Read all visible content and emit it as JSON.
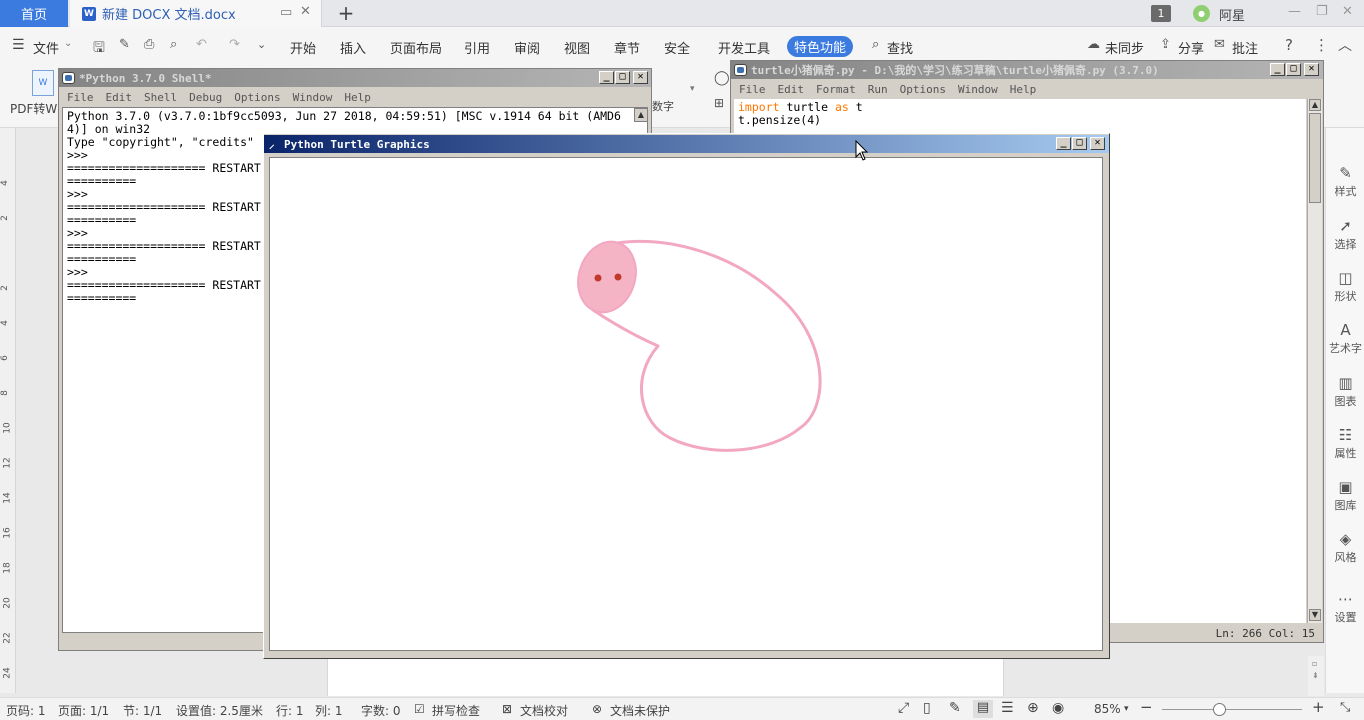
{
  "tabbar": {
    "home": "首页",
    "doc_tab": "新建 DOCX 文档.docx",
    "badge": "1",
    "user_avatar": "阿星",
    "user_name": "阿星"
  },
  "ribbon": {
    "file_menu": "文件",
    "tabs": [
      "开始",
      "插入",
      "页面布局",
      "引用",
      "审阅",
      "视图",
      "章节",
      "安全",
      "开发工具"
    ],
    "special": "特色功能",
    "search": "查找",
    "sync": "未同步",
    "share": "分享",
    "comment": "批注"
  },
  "toolbar2": {
    "pdf": "PDF转W",
    "word_art": "数字"
  },
  "ruler": [
    "4",
    "2",
    "2",
    "4",
    "6",
    "8",
    "10",
    "12",
    "14",
    "16",
    "18",
    "20",
    "22",
    "24"
  ],
  "sidebar": [
    "样式",
    "选择",
    "形状",
    "艺术字",
    "图表",
    "属性",
    "图库",
    "风格",
    "设置"
  ],
  "shell": {
    "title": "*Python 3.7.0 Shell*",
    "menu": [
      "File",
      "Edit",
      "Shell",
      "Debug",
      "Options",
      "Window",
      "Help"
    ],
    "lines": [
      "Python 3.7.0 (v3.7.0:1bf9cc5093, Jun 27 2018, 04:59:51) [MSC v.1914 64 bit (AMD6",
      "4)] on win32",
      "Type \"copyright\", \"credits\"",
      ">>>",
      "==================== RESTART",
      "==========",
      ">>>",
      "==================== RESTART",
      "==========",
      ">>>",
      "==================== RESTART",
      "==========",
      ">>>",
      "==================== RESTART",
      "=========="
    ]
  },
  "editor": {
    "title": "turtle小猪佩奇.py - D:\\我的\\学习\\练习草稿\\turtle小猪佩奇.py (3.7.0)",
    "menu": [
      "File",
      "Edit",
      "Format",
      "Run",
      "Options",
      "Window",
      "Help"
    ],
    "line1_kw": "import",
    "line1_mid": " turtle ",
    "line1_kw2": "as",
    "line1_end": " t",
    "line2": "t.pensize(4)",
    "status": "Ln: 266  Col: 15"
  },
  "turtle": {
    "title": "Python Turtle Graphics",
    "stroke_color": "#f2a7c3",
    "fill_color": "#f5b3c6",
    "eye_color": "#c0392b"
  },
  "statusbar": {
    "page_code": "页码: 1",
    "page": "页面: 1/1",
    "section": "节: 1/1",
    "setting": "设置值: 2.5厘米",
    "row": "行: 1",
    "col": "列: 1",
    "chars": "字数: 0",
    "spell": "拼写检查",
    "proof": "文档校对",
    "protect": "文档未保护",
    "zoom": "85%"
  }
}
